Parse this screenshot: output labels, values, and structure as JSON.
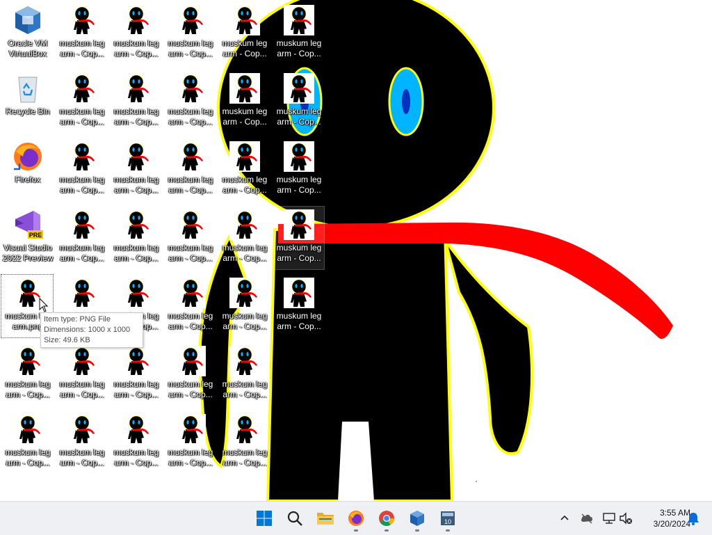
{
  "desktop": {
    "system_icons": [
      {
        "name": "virtualbox-shortcut",
        "line1": "Oracle VM",
        "line2": "VirtualBox"
      },
      {
        "name": "recycle-bin",
        "line1": "Recycle Bin",
        "line2": ""
      },
      {
        "name": "firefox-shortcut",
        "line1": "Firefox",
        "line2": ""
      },
      {
        "name": "visual-studio-shortcut",
        "line1": "Visual Studio",
        "line2": "2022 Preview",
        "badge": "PRE"
      }
    ],
    "file_icon_line1": "muskum leg",
    "file_icon_line2": "arm - Cop...",
    "selected_file": {
      "line1": "muskum leg",
      "line2": "arm.png"
    }
  },
  "tooltip": {
    "type": "Item type: PNG File",
    "dimensions": "Dimensions: 1000 x 1000",
    "size": "Size: 49.6 KB"
  },
  "taskbar": {
    "apps": [
      {
        "name": "start",
        "icon": "windows-logo-icon"
      },
      {
        "name": "search",
        "icon": "search-icon"
      },
      {
        "name": "file-explorer",
        "icon": "folder-icon",
        "running": false
      },
      {
        "name": "firefox",
        "icon": "firefox-icon",
        "running": true
      },
      {
        "name": "chrome",
        "icon": "chrome-icon",
        "running": true
      },
      {
        "name": "virtualbox",
        "icon": "virtualbox-icon",
        "running": true
      },
      {
        "name": "vm-window",
        "icon": "calculator-window-icon",
        "running": true
      }
    ],
    "clock": {
      "time": "3:55 AM",
      "date": "3/20/2024"
    }
  },
  "colors": {
    "accent": "#0067c0",
    "wallpaper_figure": "#000000",
    "outline": "#ffff00",
    "scarf": "#ff0000",
    "eye": "#00b4ff"
  }
}
